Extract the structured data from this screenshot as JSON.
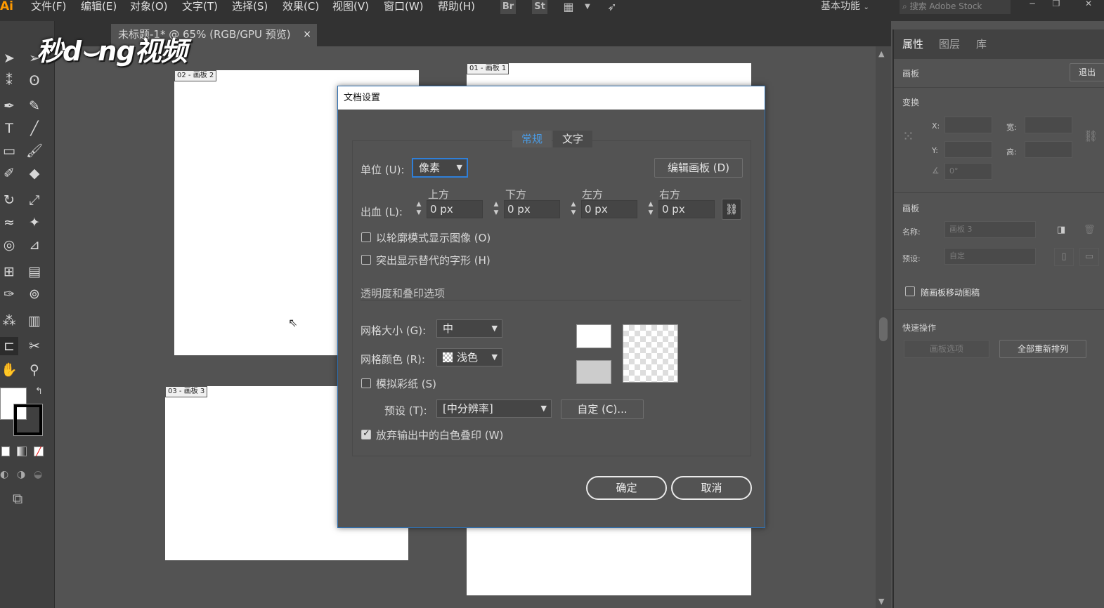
{
  "app": {
    "logo": "Ai"
  },
  "menubar": {
    "items": [
      "文件(F)",
      "编辑(E)",
      "对象(O)",
      "文字(T)",
      "选择(S)",
      "效果(C)",
      "视图(V)",
      "窗口(W)",
      "帮助(H)"
    ],
    "br_label": "Br",
    "st_label": "St",
    "workspace": "基本功能",
    "search_placeholder": "搜索 Adobe Stock"
  },
  "document_tab": {
    "title": "未标题-1* @ 65% (RGB/GPU 预览)",
    "close": "×"
  },
  "artboards": [
    {
      "label": "02 - 画板 2"
    },
    {
      "label": "01 - 画板 1"
    },
    {
      "label": "03 - 画板 3"
    }
  ],
  "watermark": "秒d⌣ng视频",
  "panel": {
    "tabs": [
      "属性",
      "图层",
      "库"
    ],
    "section_artboard_top": "画板",
    "exit_button": "退出",
    "transform_title": "变换",
    "x_label": "X:",
    "y_label": "Y:",
    "w_label": "宽:",
    "h_label": "高:",
    "angle_value": "0°",
    "artboard_title": "画板",
    "name_label": "名称:",
    "name_value": "画板 3",
    "preset_label": "预设:",
    "preset_value": "自定",
    "move_with_artboard": "随画板移动图稿",
    "quick_actions_title": "快速操作",
    "artboard_options_button": "画板选项",
    "rearrange_all_button": "全部重新排列"
  },
  "dialog": {
    "title": "文档设置",
    "tabs": [
      "常规",
      "文字"
    ],
    "units_label": "单位 (U):",
    "units_value": "像素",
    "edit_artboards_button": "编辑画板 (D)",
    "bleed_label": "出血 (L):",
    "bleed": [
      {
        "side": "上方",
        "value": "0 px"
      },
      {
        "side": "下方",
        "value": "0 px"
      },
      {
        "side": "左方",
        "value": "0 px"
      },
      {
        "side": "右方",
        "value": "0 px"
      }
    ],
    "show_images_outline": "以轮廓模式显示图像 (O)",
    "highlight_substituted_glyphs": "突出显示替代的字形 (H)",
    "transparency_section": "透明度和叠印选项",
    "grid_size_label": "网格大小 (G):",
    "grid_size_value": "中",
    "grid_colors_label": "网格颜色 (R):",
    "grid_colors_value": "浅色",
    "simulate_paper": "模拟彩纸 (S)",
    "preset_label": "预设 (T):",
    "preset_value": "[中分辨率]",
    "custom_button": "自定 (C)...",
    "discard_white_overprint": "放弃输出中的白色叠印 (W)",
    "ok_button": "确定",
    "cancel_button": "取消"
  },
  "colors": {
    "dialog_accent": "#2f7fd8",
    "app_logo": "#ff9a00"
  }
}
